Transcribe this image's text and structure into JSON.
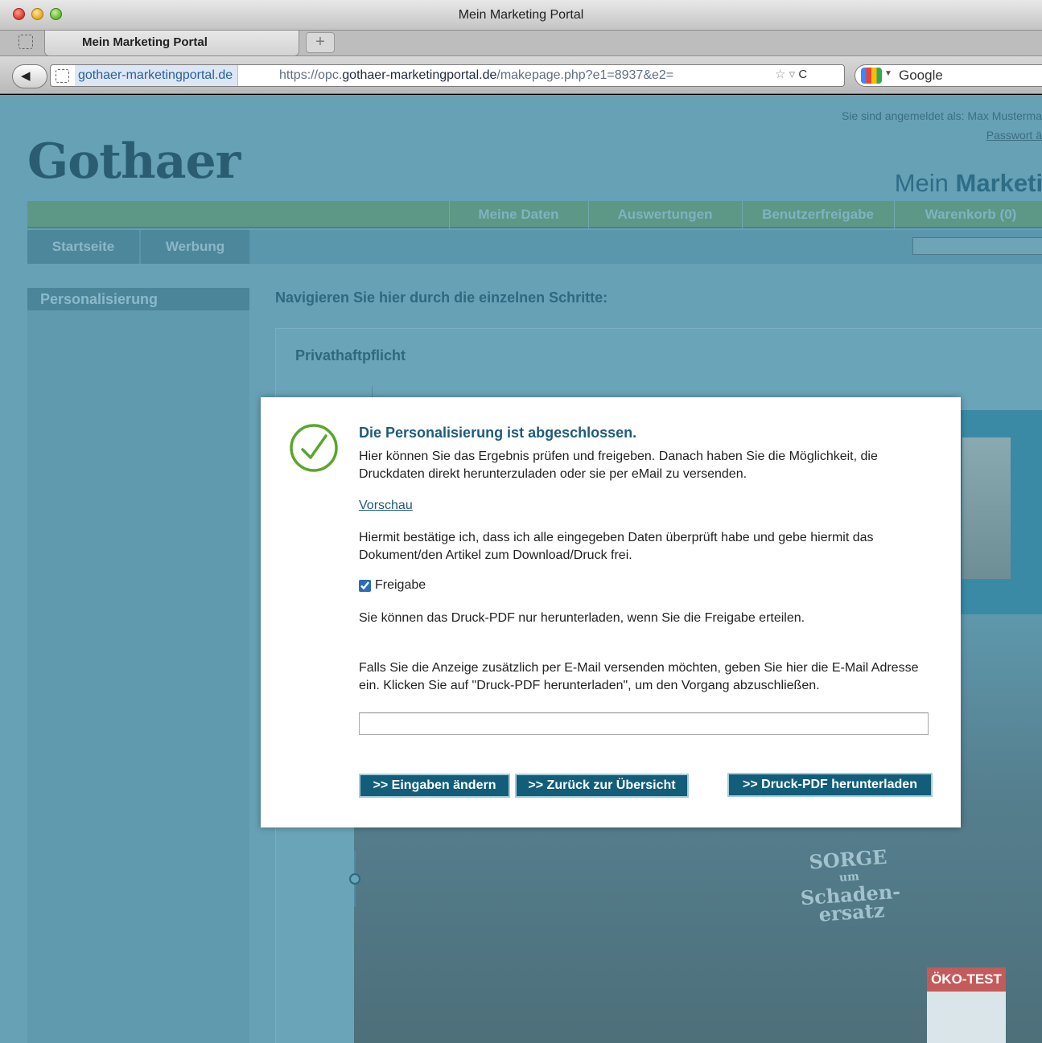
{
  "window": {
    "title": "Mein Marketing Portal"
  },
  "tab": {
    "label": "Mein Marketing Portal",
    "new_tab_label": "+"
  },
  "address": {
    "domain": "gothaer-marketingportal.de",
    "url_prefix": "https://opc.",
    "url_host": "gothaer-marketingportal.de",
    "url_path": "/makepage.php?e1=8937&e2="
  },
  "search": {
    "engine_label": "Google"
  },
  "header": {
    "login_info": "Sie sind angemeldet als: Max Musterma",
    "password_link": "Passwort ä",
    "logo_text": "Gothaer",
    "portal_title_prefix": "Mein",
    "portal_title_bold": "Marketin"
  },
  "topnav": {
    "items": [
      "Meine Daten",
      "Auswertungen",
      "Benutzerfreigabe",
      "Warenkorb (0)"
    ]
  },
  "mainnav": {
    "items": [
      "Startseite",
      "Werbung"
    ]
  },
  "sidebar": {
    "items": [
      "Personalisierung"
    ]
  },
  "main": {
    "steps_heading": "Navigieren Sie hier durch die einzelnen Schritte:",
    "product_title": "Privathaftpflicht"
  },
  "background_image": {
    "shirt_text_1": "SORGE",
    "shirt_text_2": "um",
    "shirt_text_3": "Schaden-",
    "shirt_text_4": "ersatz",
    "badge_title": "ÖKO-TEST"
  },
  "modal": {
    "heading": "Die Personalisierung ist abgeschlossen.",
    "intro": "Hier können Sie das Ergebnis prüfen und freigeben. Danach haben Sie die Möglichkeit, die Druckdaten direkt herunterzuladen oder sie per eMail zu versenden.",
    "preview_link": "Vorschau",
    "confirm_text": "Hiermit bestätige ich, dass ich alle eingegeben Daten überprüft habe und gebe hiermit das Dokument/den Artikel zum Download/Druck frei.",
    "release_label": "Freigabe",
    "release_checked": true,
    "pdf_note": "Sie können das Druck-PDF nur herunterladen, wenn Sie die Freigabe erteilen.",
    "email_text": "Falls Sie die Anzeige zusätzlich per E-Mail versenden möchten, geben Sie hier die E-Mail Adresse ein. Klicken Sie auf \"Druck-PDF herunterladen\", um den Vorgang abzuschließen.",
    "email_value": "",
    "btn_edit": ">> Eingaben ändern",
    "btn_back": ">> Zurück zur Übersicht",
    "btn_pdf": ">> Druck-PDF herunterladen",
    "success_icon": "checkmark-circle-icon"
  },
  "colors": {
    "accent": "#125e7a",
    "heading": "#1f5b7d",
    "overlay": "#66a1b6",
    "check": "#5aa62a"
  }
}
